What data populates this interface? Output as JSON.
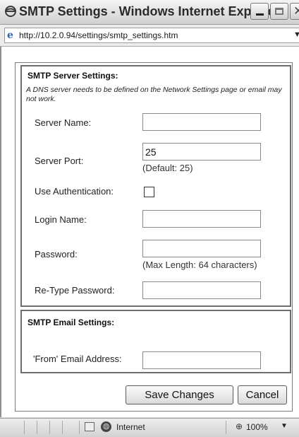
{
  "window": {
    "title": "SMTP Settings - Windows Internet Explorer",
    "minimize_glyph": "",
    "close_glyph": "✕"
  },
  "address": {
    "url": "http://10.2.0.94/settings/smtp_settings.htm",
    "dropdown_glyph": "▼"
  },
  "server": {
    "title": "SMTP Server Settings:",
    "note": "A DNS server needs to be defined on the Network Settings page or email may not work.",
    "server_name_label": "Server Name:",
    "server_name_value": "",
    "server_port_label": "Server Port:",
    "server_port_value": "25",
    "server_port_hint": "(Default: 25)",
    "use_auth_label": "Use Authentication:",
    "use_auth_checked": false,
    "login_label": "Login Name:",
    "login_value": "",
    "password_label": "Password:",
    "password_value": "",
    "password_hint": "(Max Length: 64 characters)",
    "retype_label": "Re-Type Password:",
    "retype_value": ""
  },
  "email": {
    "title": "SMTP Email Settings:",
    "from_label": "'From' Email Address:",
    "from_value": ""
  },
  "buttons": {
    "save": "Save Changes",
    "cancel": "Cancel"
  },
  "status": {
    "zone": "Internet",
    "zoom": "100%",
    "zoom_icon": "search-plus-icon",
    "zoom_drop": "▼"
  }
}
